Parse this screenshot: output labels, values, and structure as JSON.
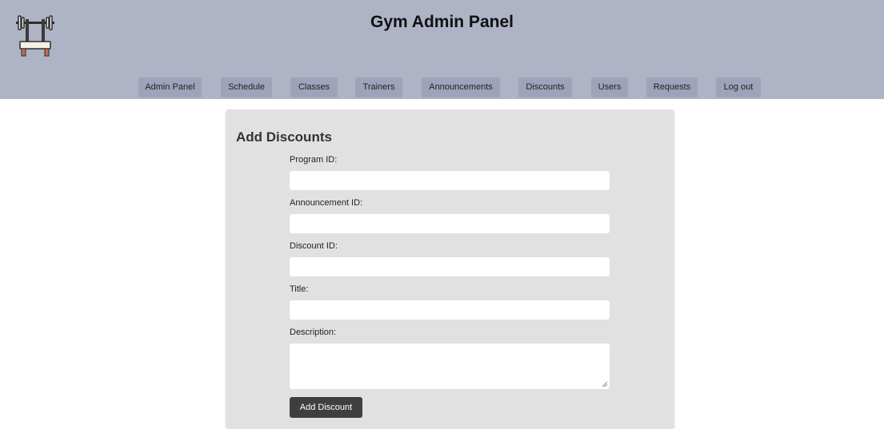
{
  "header": {
    "title": "Gym Admin Panel",
    "logo_icon": "barbell-rack-icon"
  },
  "nav": [
    {
      "id": "admin-panel",
      "label": "Admin Panel"
    },
    {
      "id": "schedule",
      "label": "Schedule"
    },
    {
      "id": "classes",
      "label": "Classes"
    },
    {
      "id": "trainers",
      "label": "Trainers"
    },
    {
      "id": "announcements",
      "label": "Announcements"
    },
    {
      "id": "discounts",
      "label": "Discounts"
    },
    {
      "id": "users",
      "label": "Users"
    },
    {
      "id": "requests",
      "label": "Requests"
    },
    {
      "id": "logout",
      "label": "Log out"
    }
  ],
  "form": {
    "title": "Add Discounts",
    "fields": [
      {
        "label": "Program ID:",
        "value": ""
      },
      {
        "label": "Announcement ID:",
        "value": ""
      },
      {
        "label": "Discount ID:",
        "value": ""
      },
      {
        "label": "Title:",
        "value": ""
      },
      {
        "label": "Description:",
        "value": ""
      }
    ],
    "submit_label": "Add Discount"
  },
  "colors": {
    "header_bg": "#aeb3c6",
    "nav_button_bg": "#9fa3b9",
    "card_bg": "#e1e1e1",
    "submit_bg": "#3f3f3f"
  }
}
